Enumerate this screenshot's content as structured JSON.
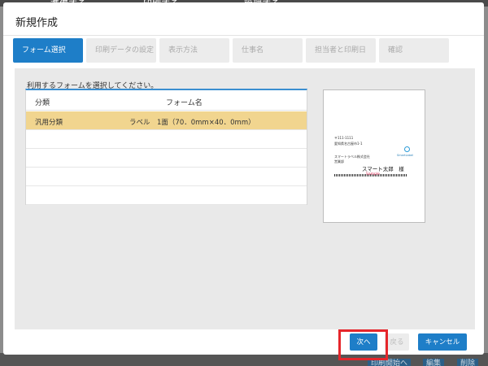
{
  "background": {
    "top_items": [
      "準備する",
      "印刷する",
      "管理する"
    ],
    "bottom_buttons": [
      "印刷開始へ",
      "編集",
      "削除"
    ]
  },
  "dialog": {
    "title": "新規作成",
    "steps": [
      {
        "label": "フォーム選択",
        "active": true
      },
      {
        "label": "印刷データの設定",
        "active": false
      },
      {
        "label": "表示方法",
        "active": false
      },
      {
        "label": "仕事名",
        "active": false
      },
      {
        "label": "担当者と印刷日",
        "active": false
      },
      {
        "label": "確認",
        "active": false
      }
    ],
    "instruction": "利用するフォームを選択してください。",
    "table": {
      "headers": [
        "分類",
        "フォーム名"
      ],
      "rows": [
        {
          "category": "汎用分類",
          "form": "ラベル　1面（70．0mm×40．0mm）",
          "selected": true
        },
        {
          "category": "",
          "form": "",
          "selected": false
        },
        {
          "category": "",
          "form": "",
          "selected": false
        },
        {
          "category": "",
          "form": "",
          "selected": false
        },
        {
          "category": "",
          "form": "",
          "selected": false
        }
      ]
    },
    "preview": {
      "postal": "〒111-1111",
      "address": "愛知県名古屋市1-1",
      "company": "スマートラベル株式会社",
      "department": "営業部",
      "name": "スマート太郎　様",
      "sample_mark": "Sample",
      "logo_text": "SmartLabel"
    },
    "buttons": {
      "next": "次へ",
      "back": "戻る",
      "cancel": "キャンセル"
    },
    "colors": {
      "accent": "#1e7ec8",
      "selected_row": "#f1d58f",
      "highlight": "#e5262b"
    }
  }
}
